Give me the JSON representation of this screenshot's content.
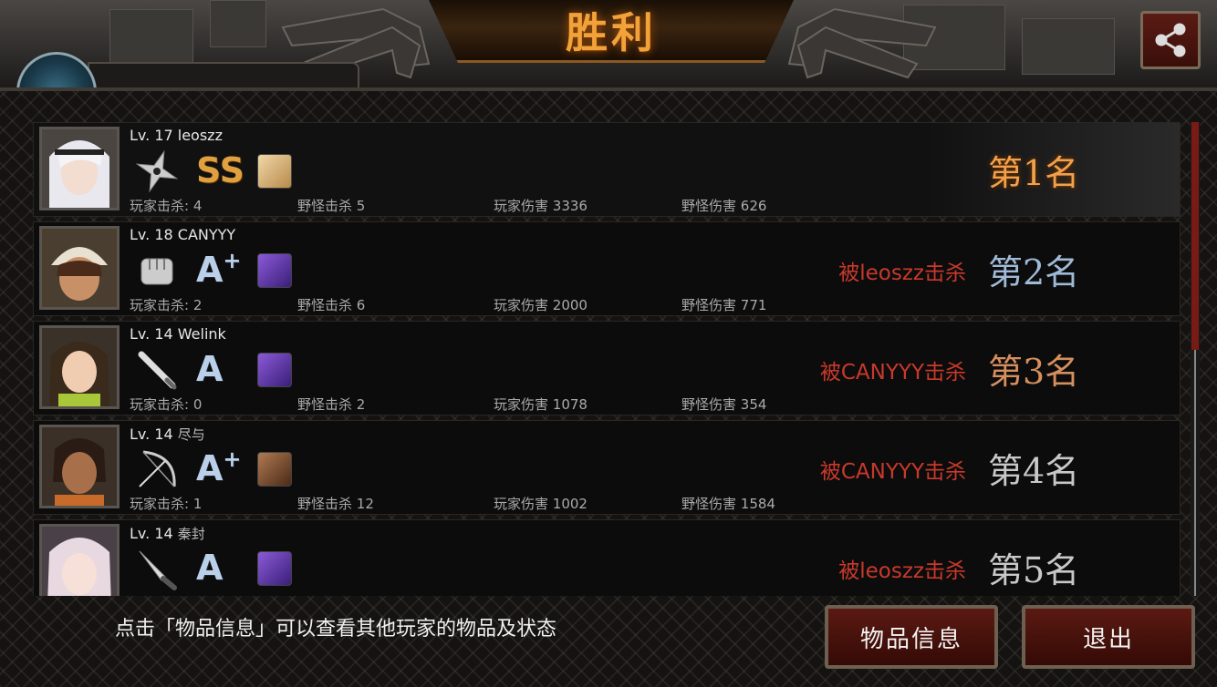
{
  "header": {
    "title": "胜利"
  },
  "players": [
    {
      "level": "Lv. 17",
      "name": "leoszz",
      "weapon_icon": "shuriken-icon",
      "grade": "SS",
      "grade_color": "#e0a040",
      "item_icon": "scroll-item-icon",
      "item_color": "#d8b070",
      "kills_label": "玩家击杀",
      "kills": "4",
      "monster_kills_label": "野怪击杀",
      "monster_kills": "5",
      "damage_label": "玩家伤害",
      "damage": "3336",
      "monster_damage_label": "野怪伤害",
      "monster_damage": "626",
      "killed_by": "",
      "rank": "第1名",
      "rank_color": "#f2a04a"
    },
    {
      "level": "Lv. 18",
      "name": "CANYYY",
      "weapon_icon": "fist-icon",
      "grade": "A",
      "grade_plus": "+",
      "grade_color": "#b9d0e8",
      "item_icon": "purple-gear-item-icon",
      "item_color": "#6a3fb0",
      "kills_label": "玩家击杀",
      "kills": "2",
      "monster_kills_label": "野怪击杀",
      "monster_kills": "6",
      "damage_label": "玩家伤害",
      "damage": "2000",
      "monster_damage_label": "野怪伤害",
      "monster_damage": "771",
      "killed_by": "被leoszz击杀",
      "rank": "第2名",
      "rank_color": "#9fb9d6"
    },
    {
      "level": "Lv. 14",
      "name": "Welink",
      "weapon_icon": "bat-icon",
      "grade": "A",
      "grade_plus": "",
      "grade_color": "#b9d0e8",
      "item_icon": "purple-gear-item-icon",
      "item_color": "#6a3fb0",
      "kills_label": "玩家击杀",
      "kills": "0",
      "monster_kills_label": "野怪击杀",
      "monster_kills": "2",
      "damage_label": "玩家伤害",
      "damage": "1078",
      "monster_damage_label": "野怪伤害",
      "monster_damage": "354",
      "killed_by": "被CANYYY击杀",
      "rank": "第3名",
      "rank_color": "#d58f5e"
    },
    {
      "level": "Lv. 14",
      "name": "尽与",
      "weapon_icon": "bow-icon",
      "grade": "A",
      "grade_plus": "+",
      "grade_color": "#b9d0e8",
      "item_icon": "crossed-blades-item-icon",
      "item_color": "#8a5a3a",
      "kills_label": "玩家击杀",
      "kills": "1",
      "monster_kills_label": "野怪击杀",
      "monster_kills": "12",
      "damage_label": "玩家伤害",
      "damage": "1002",
      "monster_damage_label": "野怪伤害",
      "monster_damage": "1584",
      "killed_by": "被CANYYY击杀",
      "rank": "第4名",
      "rank_color": "#c8c8c8"
    },
    {
      "level": "Lv. 14",
      "name": "秦封",
      "weapon_icon": "knife-icon",
      "grade": "A",
      "grade_plus": "",
      "grade_color": "#b9d0e8",
      "item_icon": "purple-gear-item-icon",
      "item_color": "#6a3fb0",
      "killed_by": "被leoszz击杀",
      "rank": "第5名",
      "rank_color": "#c8c8c8"
    }
  ],
  "footer": {
    "hint": "点击「物品信息」可以查看其他玩家的物品及状态",
    "item_info_button": "物品信息",
    "exit_button": "退出"
  },
  "colors": {
    "accent_gold": "#f3a23a",
    "killed_red": "#c9392b",
    "button_red": "#5a1a12"
  }
}
